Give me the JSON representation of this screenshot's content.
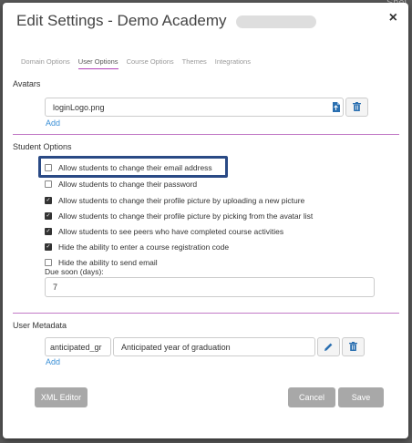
{
  "backdrop": {
    "corner_text": "Shel"
  },
  "dialog": {
    "title": "Edit Settings - Demo Academy",
    "close_glyph": "×"
  },
  "tabs": [
    {
      "label": "Domain Options",
      "active": false
    },
    {
      "label": "User Options",
      "active": true
    },
    {
      "label": "Course Options",
      "active": false
    },
    {
      "label": "Themes",
      "active": false
    },
    {
      "label": "Integrations",
      "active": false
    }
  ],
  "avatars": {
    "section_label": "Avatars",
    "file_value": "loginLogo.png",
    "add_label": "Add"
  },
  "student_options": {
    "section_label": "Student Options",
    "options": [
      {
        "label": "Allow students to change their email address",
        "checked": false
      },
      {
        "label": "Allow students to change their password",
        "checked": false
      },
      {
        "label": "Allow students to change their profile picture by uploading a new picture",
        "checked": true
      },
      {
        "label": "Allow students to change their profile picture by picking from the avatar list",
        "checked": true
      },
      {
        "label": "Allow students to see peers who have completed course activities",
        "checked": true
      },
      {
        "label": "Hide the ability to enter a course registration code",
        "checked": true
      },
      {
        "label": "Hide the ability to send email",
        "checked": false
      }
    ],
    "due_soon_label": "Due soon (days):",
    "due_soon_value": "7"
  },
  "user_metadata": {
    "section_label": "User Metadata",
    "key_value": "anticipated_gr",
    "description_value": "Anticipated year of graduation",
    "add_label": "Add"
  },
  "footer": {
    "xml_editor_label": "XML Editor",
    "cancel_label": "Cancel",
    "save_label": "Save"
  },
  "colors": {
    "accent_purple": "#b040b8",
    "link_blue": "#3a8fd6",
    "highlight_navy": "#2a4a85",
    "button_gray": "#a8a8a8"
  }
}
